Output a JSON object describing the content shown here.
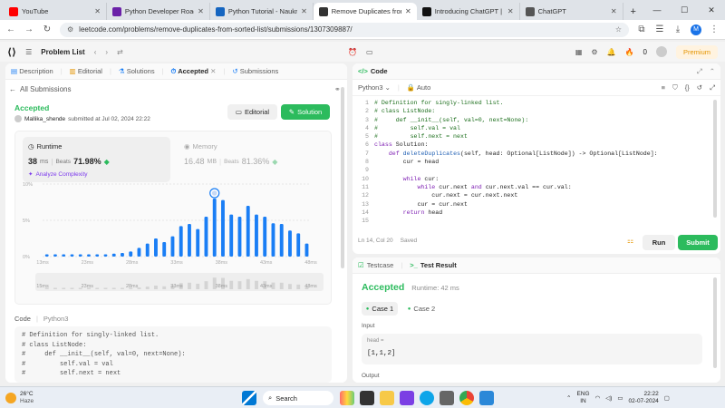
{
  "browser": {
    "tabs": [
      {
        "title": "YouTube",
        "color": "#ff0000",
        "active": false
      },
      {
        "title": "Python Developer Roadmap",
        "color": "#6b21a8",
        "active": false
      },
      {
        "title": "Python Tutorial - Naukri Co",
        "color": "#1565c0",
        "active": false
      },
      {
        "title": "Remove Duplicates from S",
        "color": "#333333",
        "active": true
      },
      {
        "title": "Introducing ChatGPT | Ope",
        "color": "#111111",
        "active": false
      },
      {
        "title": "ChatGPT",
        "color": "#555555",
        "active": false
      }
    ],
    "new_tab": "+",
    "url": "leetcode.com/problems/remove-duplicates-from-sorted-list/submissions/1307309887/"
  },
  "lc_header": {
    "problem_list": "Problem List",
    "coins": "0",
    "premium": "Premium"
  },
  "left": {
    "tabs": [
      "Description",
      "Editorial",
      "Solutions",
      "Accepted",
      "Submissions"
    ],
    "all_submissions": "All Submissions",
    "status": "Accepted",
    "user": "Mallika_shende",
    "submitted": "submitted at Jul 02, 2024 22:22",
    "editorial_btn": "Editorial",
    "solution_btn": "Solution",
    "runtime_label": "Runtime",
    "runtime_value": "38",
    "runtime_unit": "ms",
    "runtime_beats_label": "Beats",
    "runtime_beats": "71.98%",
    "analyze": "Analyze Complexity",
    "memory_label": "Memory",
    "memory_value": "16.48",
    "memory_unit": "MB",
    "memory_beats_label": "Beats",
    "memory_beats": "81.36%",
    "code_label": "Code",
    "code_lang": "Python3",
    "code_lines": [
      "# Definition for singly-linked list.",
      "# class ListNode:",
      "#     def __init__(self, val=0, next=None):",
      "#         self.val = val",
      "#         self.next = next"
    ]
  },
  "chart_data": {
    "type": "bar",
    "yticks": [
      "10%",
      "5%",
      "0%"
    ],
    "xticks": [
      "13ms",
      "23ms",
      "28ms",
      "33ms",
      "38ms",
      "43ms",
      "48ms"
    ],
    "mini_xticks": [
      "15ms",
      "23ms",
      "28ms",
      "33ms",
      "38ms",
      "43ms",
      "48ms"
    ],
    "ylim": [
      0,
      10
    ],
    "values": [
      0.3,
      0.3,
      0.3,
      0.3,
      0.3,
      0.3,
      0.3,
      0.3,
      0.4,
      0.5,
      0.7,
      1.2,
      1.8,
      2.5,
      2.0,
      2.8,
      4.2,
      4.5,
      3.8,
      5.5,
      8.0,
      7.8,
      5.8,
      5.5,
      7.0,
      5.8,
      5.5,
      4.6,
      4.5,
      3.6,
      3.2,
      1.8
    ],
    "highlight_index": 20,
    "bar_color": "#1a7ef5"
  },
  "editor": {
    "title": "Code",
    "lang": "Python3",
    "mode": "Auto",
    "status": "Ln 14, Col 20",
    "saved": "Saved",
    "run": "Run",
    "submit": "Submit",
    "lines": [
      "# Definition for singly-linked list.",
      "# class ListNode:",
      "#     def __init__(self, val=0, next=None):",
      "#         self.val = val",
      "#         self.next = next",
      "class Solution:",
      "    def deleteDuplicates(self, head: Optional[ListNode]) -> Optional[ListNode]:",
      "        cur = head",
      "",
      "        while cur:",
      "            while cur.next and cur.next.val == cur.val:",
      "                cur.next = cur.next.next",
      "            cur = cur.next",
      "        return head",
      ""
    ]
  },
  "testpanel": {
    "tab1": "Testcase",
    "tab2": "Test Result",
    "result": "Accepted",
    "runtime": "Runtime: 42 ms",
    "case1": "Case 1",
    "case2": "Case 2",
    "input_label": "Input",
    "var": "head =",
    "value": "[1,1,2]",
    "output_label": "Output"
  },
  "taskbar": {
    "temp": "26°C",
    "weather": "Haze",
    "search": "Search",
    "lang1": "ENG",
    "lang2": "IN",
    "time": "22:22",
    "date": "02-07-2024"
  }
}
